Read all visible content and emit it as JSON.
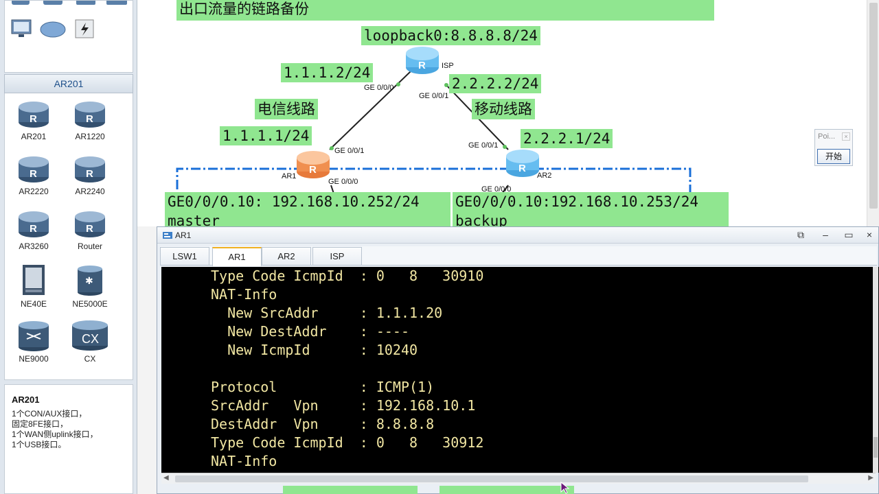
{
  "left_panel": {
    "header": "AR201",
    "devices": [
      {
        "name": "AR201"
      },
      {
        "name": "AR1220"
      },
      {
        "name": "AR2220"
      },
      {
        "name": "AR2240"
      },
      {
        "name": "AR3260"
      },
      {
        "name": "Router"
      },
      {
        "name": "NE40E"
      },
      {
        "name": "NE5000E"
      },
      {
        "name": "NE9000"
      },
      {
        "name": "CX"
      }
    ],
    "desc_title": "AR201",
    "desc_lines": [
      "1个CON/AUX接口，",
      "固定8FE接口，",
      "1个WAN侧uplink接口，",
      "1个USB接口。"
    ]
  },
  "topology": {
    "title": "出口流量的链路备份",
    "loopback": "loopback0:8.8.8.8/24",
    "isp_label": "ISP",
    "ip_isp_left": "1.1.1.2/24",
    "ip_isp_right": "2.2.2.2/24",
    "line_left": "电信线路",
    "line_right": "移动线路",
    "ip_ar1": "1.1.1.1/24",
    "ip_ar2": "2.2.2.1/24",
    "ar1_label": "AR1",
    "ar2_label": "AR2",
    "ports": {
      "isp_g0": "GE 0/0/0",
      "isp_g1": "GE 0/0/1",
      "ar1_g1": "GE 0/0/1",
      "ar1_g0": "GE 0/0/0",
      "ar2_g1": "GE 0/0/1",
      "ar2_g0": "GE 0/0/0"
    },
    "sub_ar1_ip": "GE0/0/0.10: 192.168.10.252/24",
    "sub_ar1_role": "master",
    "sub_ar2_ip": "GE0/0/0.10:192.168.10.253/24",
    "sub_ar2_role": " backup"
  },
  "mini_window": {
    "title": "Poi...",
    "button": "开始"
  },
  "terminal": {
    "title": "AR1",
    "tabs": [
      "LSW1",
      "AR1",
      "AR2",
      "ISP"
    ],
    "active_tab": "AR1",
    "lines": [
      "Type Code IcmpId  : 0   8   30910",
      "NAT-Info",
      "  New SrcAddr     : 1.1.1.20",
      "  New DestAddr    : ----",
      "  New IcmpId      : 10240",
      "",
      "Protocol          : ICMP(1)",
      "SrcAddr   Vpn     : 192.168.10.1",
      "DestAddr  Vpn     : 8.8.8.8",
      "Type Code IcmpId  : 0   8   30912",
      "NAT-Info"
    ]
  },
  "colors": {
    "label_bg": "#90e690",
    "term_text": "#f2e7a3",
    "vlan_dash": "#1a6fd8"
  }
}
